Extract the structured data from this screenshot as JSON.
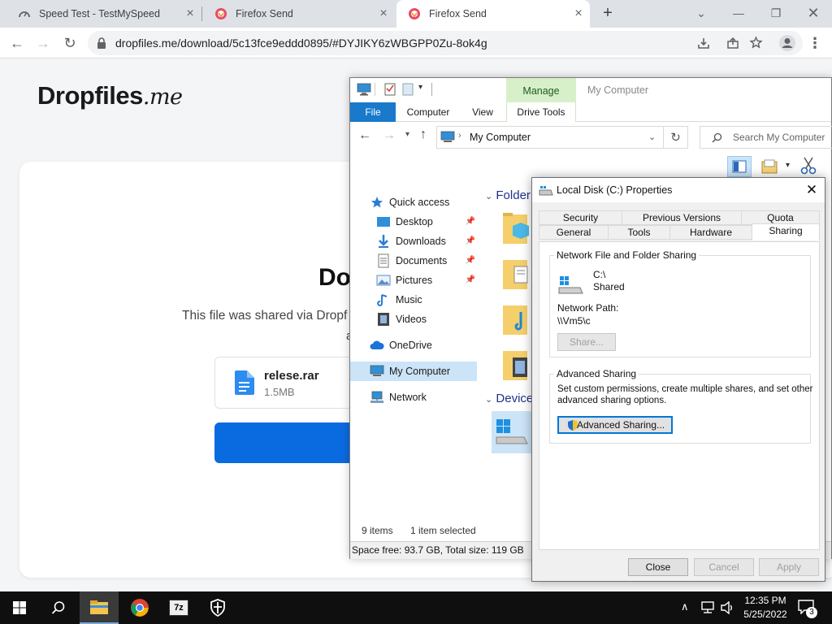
{
  "browser": {
    "tabs": [
      {
        "title": "Speed Test - TestMySpeed",
        "icon": "gauge-icon"
      },
      {
        "title": "Firefox Send",
        "icon": "firefox-send-icon"
      },
      {
        "title": "Firefox Send",
        "icon": "firefox-send-icon"
      }
    ],
    "new_tab": "+",
    "url": "dropfiles.me/download/5c13fce9eddd0895/#DYJIKY6zWBGPP0Zu-8ok4g"
  },
  "page": {
    "logo_main": "Dropfiles",
    "logo_suffix": ".me",
    "heading": "Do",
    "subtitle": "This file was shared via Dropf",
    "subtitle_cont": "a",
    "file": {
      "name": "relese.rar",
      "size": "1.5MB"
    }
  },
  "explorer": {
    "context_tab": "Manage",
    "title": "My Computer",
    "tabs": [
      "File",
      "Computer",
      "View",
      "Drive Tools"
    ],
    "address": "My Computer",
    "search_placeholder": "Search My Computer",
    "nav": [
      {
        "label": "Quick access",
        "icon": "star-icon"
      },
      {
        "label": "Desktop",
        "icon": "desktop-icon",
        "pinned": true
      },
      {
        "label": "Downloads",
        "icon": "download-arrow-icon",
        "pinned": true
      },
      {
        "label": "Documents",
        "icon": "document-icon",
        "pinned": true
      },
      {
        "label": "Pictures",
        "icon": "pictures-icon",
        "pinned": true
      },
      {
        "label": "Music",
        "icon": "music-note-icon"
      },
      {
        "label": "Videos",
        "icon": "film-icon"
      },
      {
        "label": "OneDrive",
        "icon": "cloud-icon"
      },
      {
        "label": "My Computer",
        "icon": "computer-icon",
        "selected": true
      },
      {
        "label": "Network",
        "icon": "network-icon"
      }
    ],
    "section_folders": "Folder",
    "section_devices": "Device",
    "status_items": "9 items",
    "status_selected": "1 item selected",
    "space": "Space free: 93.7 GB, Total size: 119 GB"
  },
  "props": {
    "title": "Local Disk (C:) Properties",
    "tabs_row1": [
      "Security",
      "Previous Versions",
      "Quota"
    ],
    "tabs_row2": [
      "General",
      "Tools",
      "Hardware",
      "Sharing"
    ],
    "nfs_group": "Network File and Folder Sharing",
    "drive_name": "C:\\",
    "drive_state": "Shared",
    "network_path_label": "Network Path:",
    "network_path": "\\\\Vm5\\c",
    "share_button": "Share...",
    "adv_group": "Advanced Sharing",
    "adv_desc1": "Set custom permissions, create multiple shares, and set other",
    "adv_desc2": "advanced sharing options.",
    "adv_button": "Advanced Sharing...",
    "close": "Close",
    "cancel": "Cancel",
    "apply": "Apply"
  },
  "taskbar": {
    "time": "12:35 PM",
    "date": "5/25/2022",
    "notification_count": "3",
    "apps": [
      "file-explorer-icon",
      "chrome-icon",
      "7zip-icon",
      "security-shield-icon"
    ]
  },
  "colors": {
    "accent": "#1979ca",
    "download_button": "#0a6be0",
    "manage_tab": "#d7f0c9"
  }
}
